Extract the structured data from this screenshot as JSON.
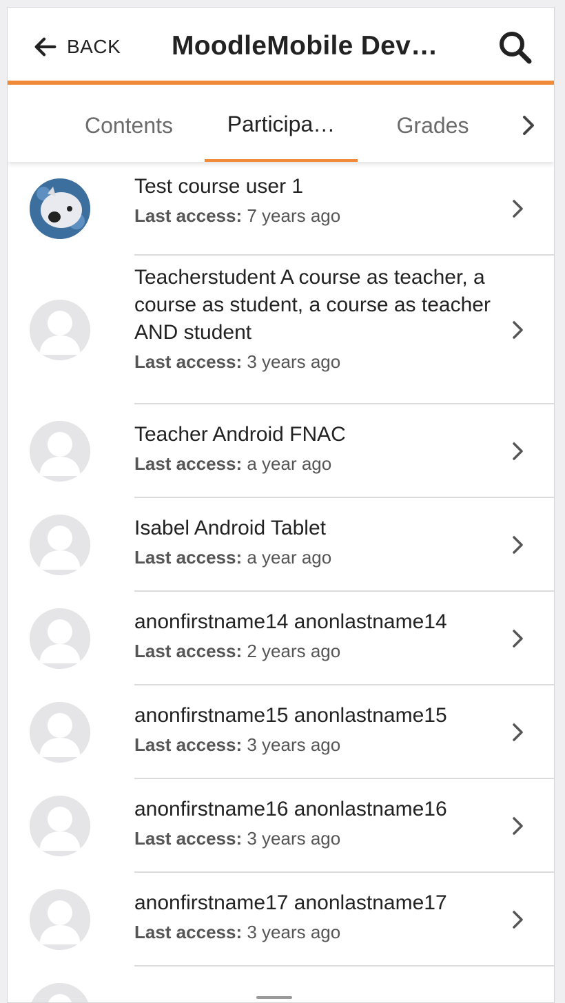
{
  "header": {
    "back_label": "BACK",
    "title": "MoodleMobile Dev…",
    "back_icon": "arrow-left-icon",
    "search_icon": "search-icon",
    "accent_color": "#f08a39"
  },
  "tabs": [
    {
      "label": "Contents",
      "active": false
    },
    {
      "label": "Participa…",
      "active": true
    },
    {
      "label": "Grades",
      "active": false
    }
  ],
  "participants": [
    {
      "name": "Test course user 1",
      "access_label": "Last access:",
      "access_value": "7 years ago",
      "avatar": "photo-pig"
    },
    {
      "name": "Teacherstudent A course as teacher, a course as student, a course as teacher AND student",
      "access_label": "Last access:",
      "access_value": "3 years ago",
      "avatar": "default-user"
    },
    {
      "name": "Teacher Android FNAC",
      "access_label": "Last access:",
      "access_value": "a year ago",
      "avatar": "default-user"
    },
    {
      "name": "Isabel Android Tablet",
      "access_label": "Last access:",
      "access_value": "a year ago",
      "avatar": "default-user"
    },
    {
      "name": "anonfirstname14 anonlastname14",
      "access_label": "Last access:",
      "access_value": "2 years ago",
      "avatar": "default-user"
    },
    {
      "name": "anonfirstname15 anonlastname15",
      "access_label": "Last access:",
      "access_value": "3 years ago",
      "avatar": "default-user"
    },
    {
      "name": "anonfirstname16 anonlastname16",
      "access_label": "Last access:",
      "access_value": "3 years ago",
      "avatar": "default-user"
    },
    {
      "name": "anonfirstname17 anonlastname17",
      "access_label": "Last access:",
      "access_value": "3 years ago",
      "avatar": "default-user"
    }
  ]
}
